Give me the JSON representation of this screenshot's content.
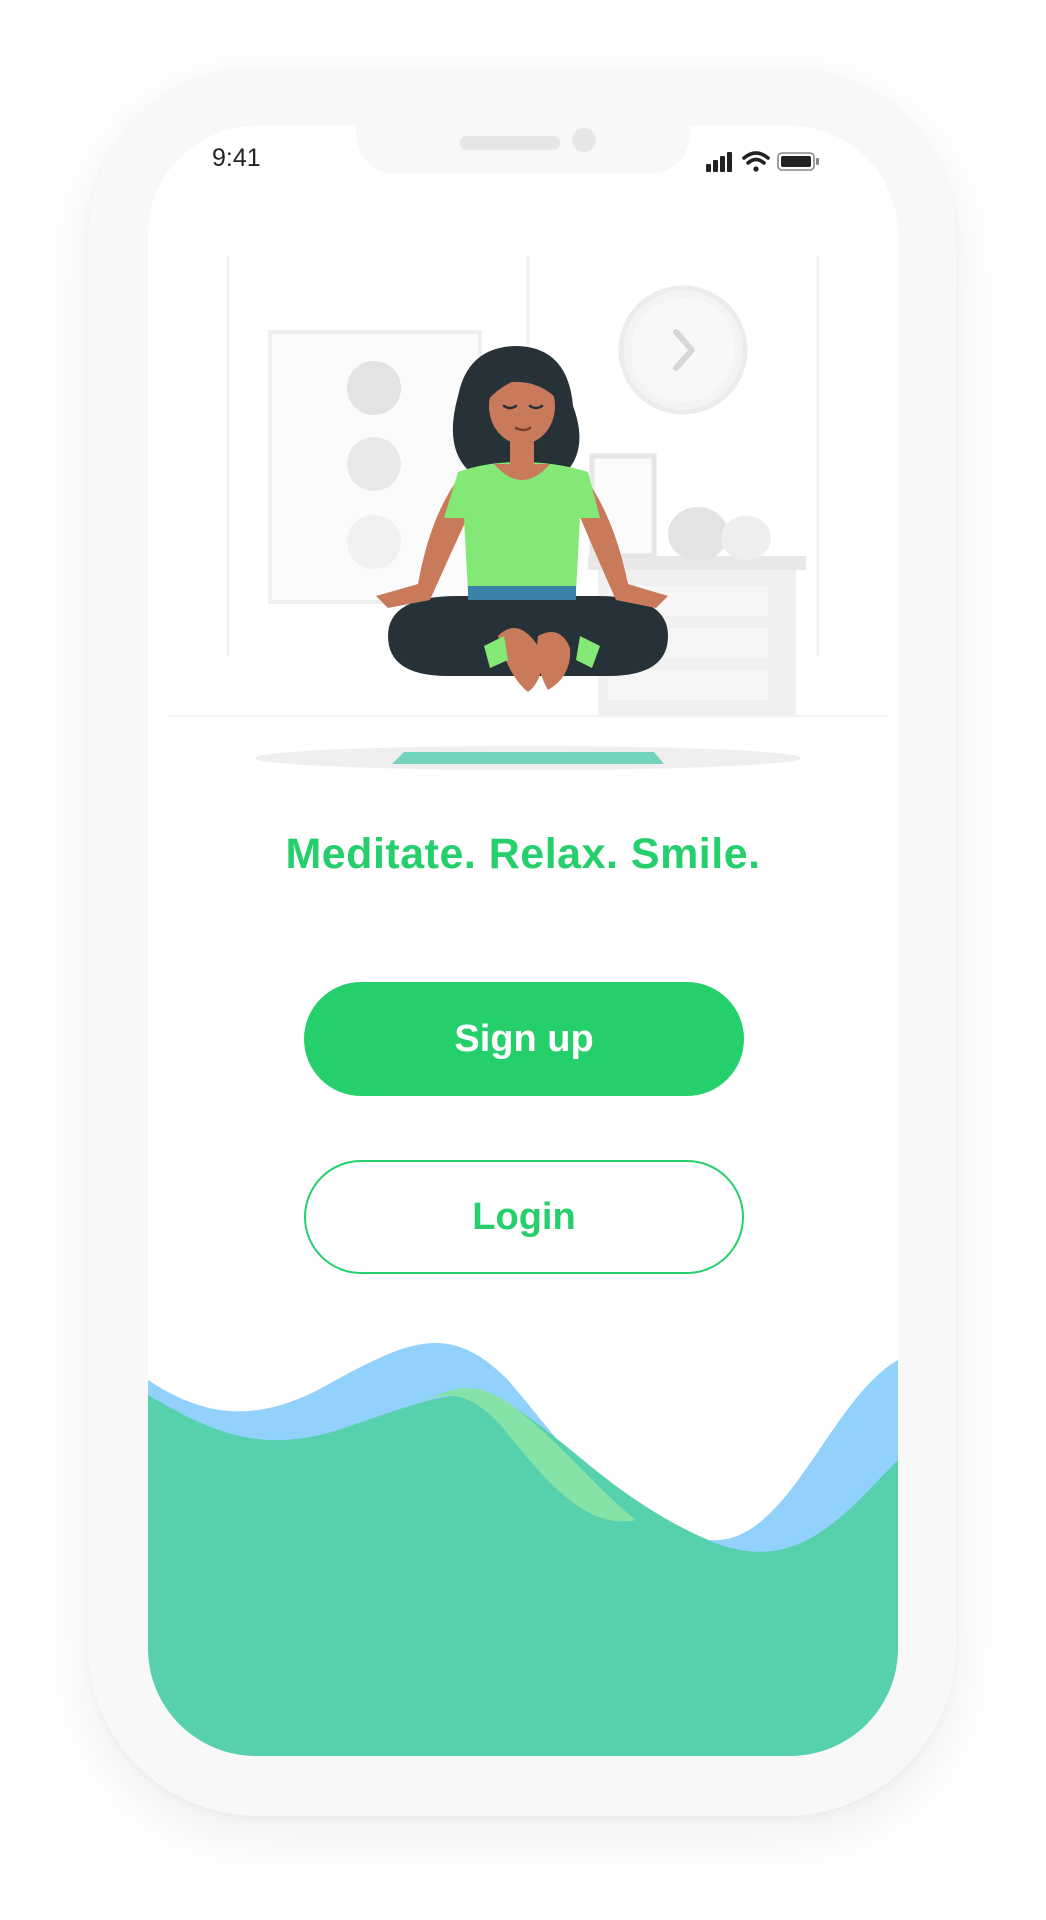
{
  "status_bar": {
    "time": "9:41"
  },
  "main": {
    "tagline": "Meditate. Relax. Smile."
  },
  "actions": {
    "signup_label": "Sign up",
    "login_label": "Login"
  },
  "colors": {
    "accent": "#25cf6c",
    "wave_blue": "#91d1fb",
    "wave_green": "#57d0ad",
    "wave_light_green": "#86e3a8",
    "shirt": "#84e877",
    "pants": "#263238",
    "skin": "#c97a5b",
    "mat": "#71d2bd"
  },
  "icons": {
    "signal": "signal-icon",
    "wifi": "wifi-icon",
    "battery": "battery-icon"
  }
}
